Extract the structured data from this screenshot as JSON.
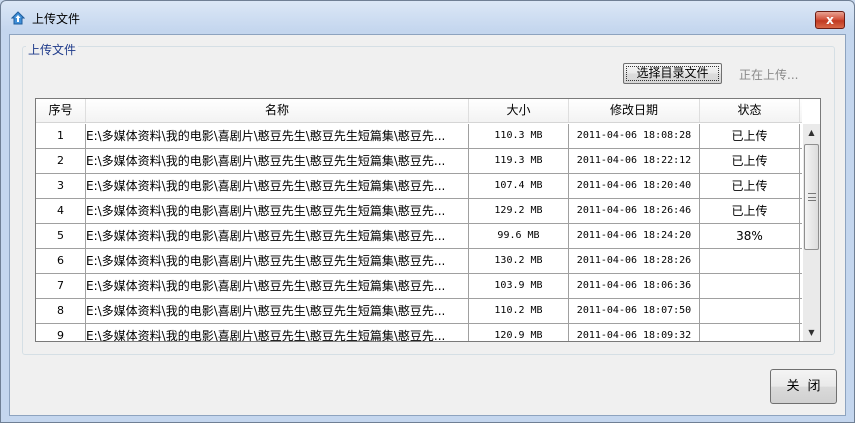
{
  "window": {
    "title": "上传文件",
    "close_glyph": "x",
    "app_icon": "house-upload-icon"
  },
  "groupbox": {
    "legend": "上传文件"
  },
  "toolbar": {
    "select_button_label": "选择目录文件",
    "status_text": "正在上传..."
  },
  "table": {
    "headers": {
      "index": "序号",
      "name": "名称",
      "size": "大小",
      "date": "修改日期",
      "state": "状态"
    },
    "rows": [
      {
        "index": "1",
        "name": "E:\\多媒体资料\\我的电影\\喜剧片\\憨豆先生\\憨豆先生短篇集\\憨豆先...",
        "size": "110.3 MB",
        "date": "2011-04-06 18:08:28",
        "state": "已上传"
      },
      {
        "index": "2",
        "name": "E:\\多媒体资料\\我的电影\\喜剧片\\憨豆先生\\憨豆先生短篇集\\憨豆先...",
        "size": "119.3 MB",
        "date": "2011-04-06 18:22:12",
        "state": "已上传"
      },
      {
        "index": "3",
        "name": "E:\\多媒体资料\\我的电影\\喜剧片\\憨豆先生\\憨豆先生短篇集\\憨豆先...",
        "size": "107.4 MB",
        "date": "2011-04-06 18:20:40",
        "state": "已上传"
      },
      {
        "index": "4",
        "name": "E:\\多媒体资料\\我的电影\\喜剧片\\憨豆先生\\憨豆先生短篇集\\憨豆先...",
        "size": "129.2 MB",
        "date": "2011-04-06 18:26:46",
        "state": "已上传"
      },
      {
        "index": "5",
        "name": "E:\\多媒体资料\\我的电影\\喜剧片\\憨豆先生\\憨豆先生短篇集\\憨豆先...",
        "size": "99.6 MB",
        "date": "2011-04-06 18:24:20",
        "state": "38%"
      },
      {
        "index": "6",
        "name": "E:\\多媒体资料\\我的电影\\喜剧片\\憨豆先生\\憨豆先生短篇集\\憨豆先...",
        "size": "130.2 MB",
        "date": "2011-04-06 18:28:26",
        "state": ""
      },
      {
        "index": "7",
        "name": "E:\\多媒体资料\\我的电影\\喜剧片\\憨豆先生\\憨豆先生短篇集\\憨豆先...",
        "size": "103.9 MB",
        "date": "2011-04-06 18:06:36",
        "state": ""
      },
      {
        "index": "8",
        "name": "E:\\多媒体资料\\我的电影\\喜剧片\\憨豆先生\\憨豆先生短篇集\\憨豆先...",
        "size": "110.2 MB",
        "date": "2011-04-06 18:07:50",
        "state": ""
      },
      {
        "index": "9",
        "name": "E:\\多媒体资料\\我的电影\\喜剧片\\憨豆先生\\憨豆先生短篇集\\憨豆先...",
        "size": "120.9 MB",
        "date": "2011-04-06 18:09:32",
        "state": ""
      }
    ]
  },
  "footer": {
    "close_button_label": "关闭"
  },
  "colors": {
    "title_bar": "#c4d6ee",
    "close_red": "#c03a22",
    "legend_text": "#1e3a8a"
  }
}
